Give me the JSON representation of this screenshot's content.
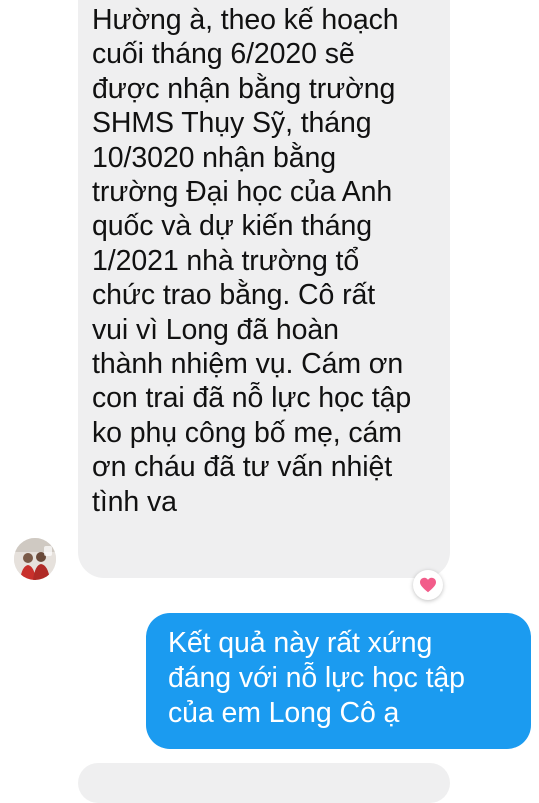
{
  "conversation": {
    "incoming_message": {
      "lines": [
        "Hường à, theo kế hoạch",
        "cuối tháng 6/2020 sẽ",
        "được nhận bằng trường",
        "SHMS Thụy Sỹ, tháng",
        "10/3020 nhận bằng",
        "trường Đại học của Anh",
        "quốc và dự kiến tháng",
        "1/2021 nhà trường tổ",
        "chức trao bằng. Cô rất",
        "vui vì Long đã hoàn",
        "thành nhiệm vụ. Cám ơn",
        "con trai đã nỗ lực học tập",
        "ko phụ công bố mẹ, cám",
        "ơn cháu đã tư vấn nhiệt",
        "tình va"
      ],
      "bubble_color": "#efeff0",
      "text_color": "#111111"
    },
    "reaction": {
      "icon": "heart-icon",
      "color": "#f25c8a"
    },
    "avatar": {
      "icon": "contact-avatar"
    },
    "outgoing_message": {
      "lines": [
        "Kết quả này rất xứng",
        "đáng với nỗ lực học tập",
        "của em Long Cô ạ"
      ],
      "bubble_color": "#1b9bf0",
      "text_color": "#ffffff"
    }
  }
}
